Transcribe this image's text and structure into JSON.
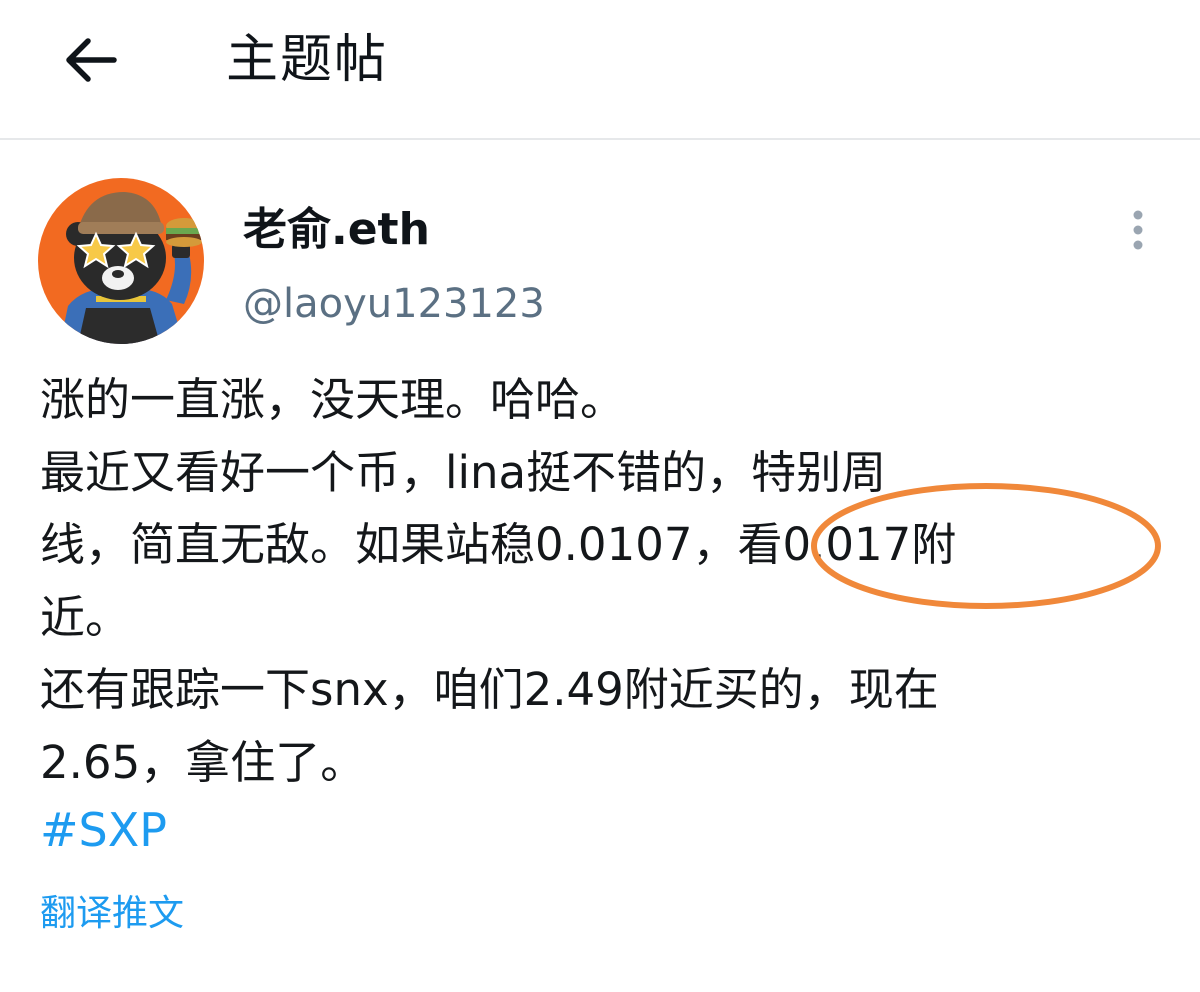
{
  "header": {
    "title": "主题帖",
    "back_icon": "arrow-left-icon"
  },
  "author": {
    "display_name": "老俞.eth",
    "handle": "@laoyu123123",
    "avatar_icon": "avatar-cartoon-bear"
  },
  "tweet": {
    "lines": [
      "涨的一直涨，没天理。哈哈。",
      "最近又看好一个币，lina挺不错的，特别周",
      "线，简直无敌。如果站稳0.0107，看0.017附",
      "近。",
      "还有跟踪一下snx，咱们2.49附近买的，现在",
      "2.65，拿住了。"
    ],
    "hashtag": "#SXP",
    "translate_label": "翻译推文"
  },
  "colors": {
    "link": "#1d9bf0",
    "handle": "#5b7083",
    "highlight_ring": "#f0883a",
    "avatar_bg": "#f26a21"
  }
}
